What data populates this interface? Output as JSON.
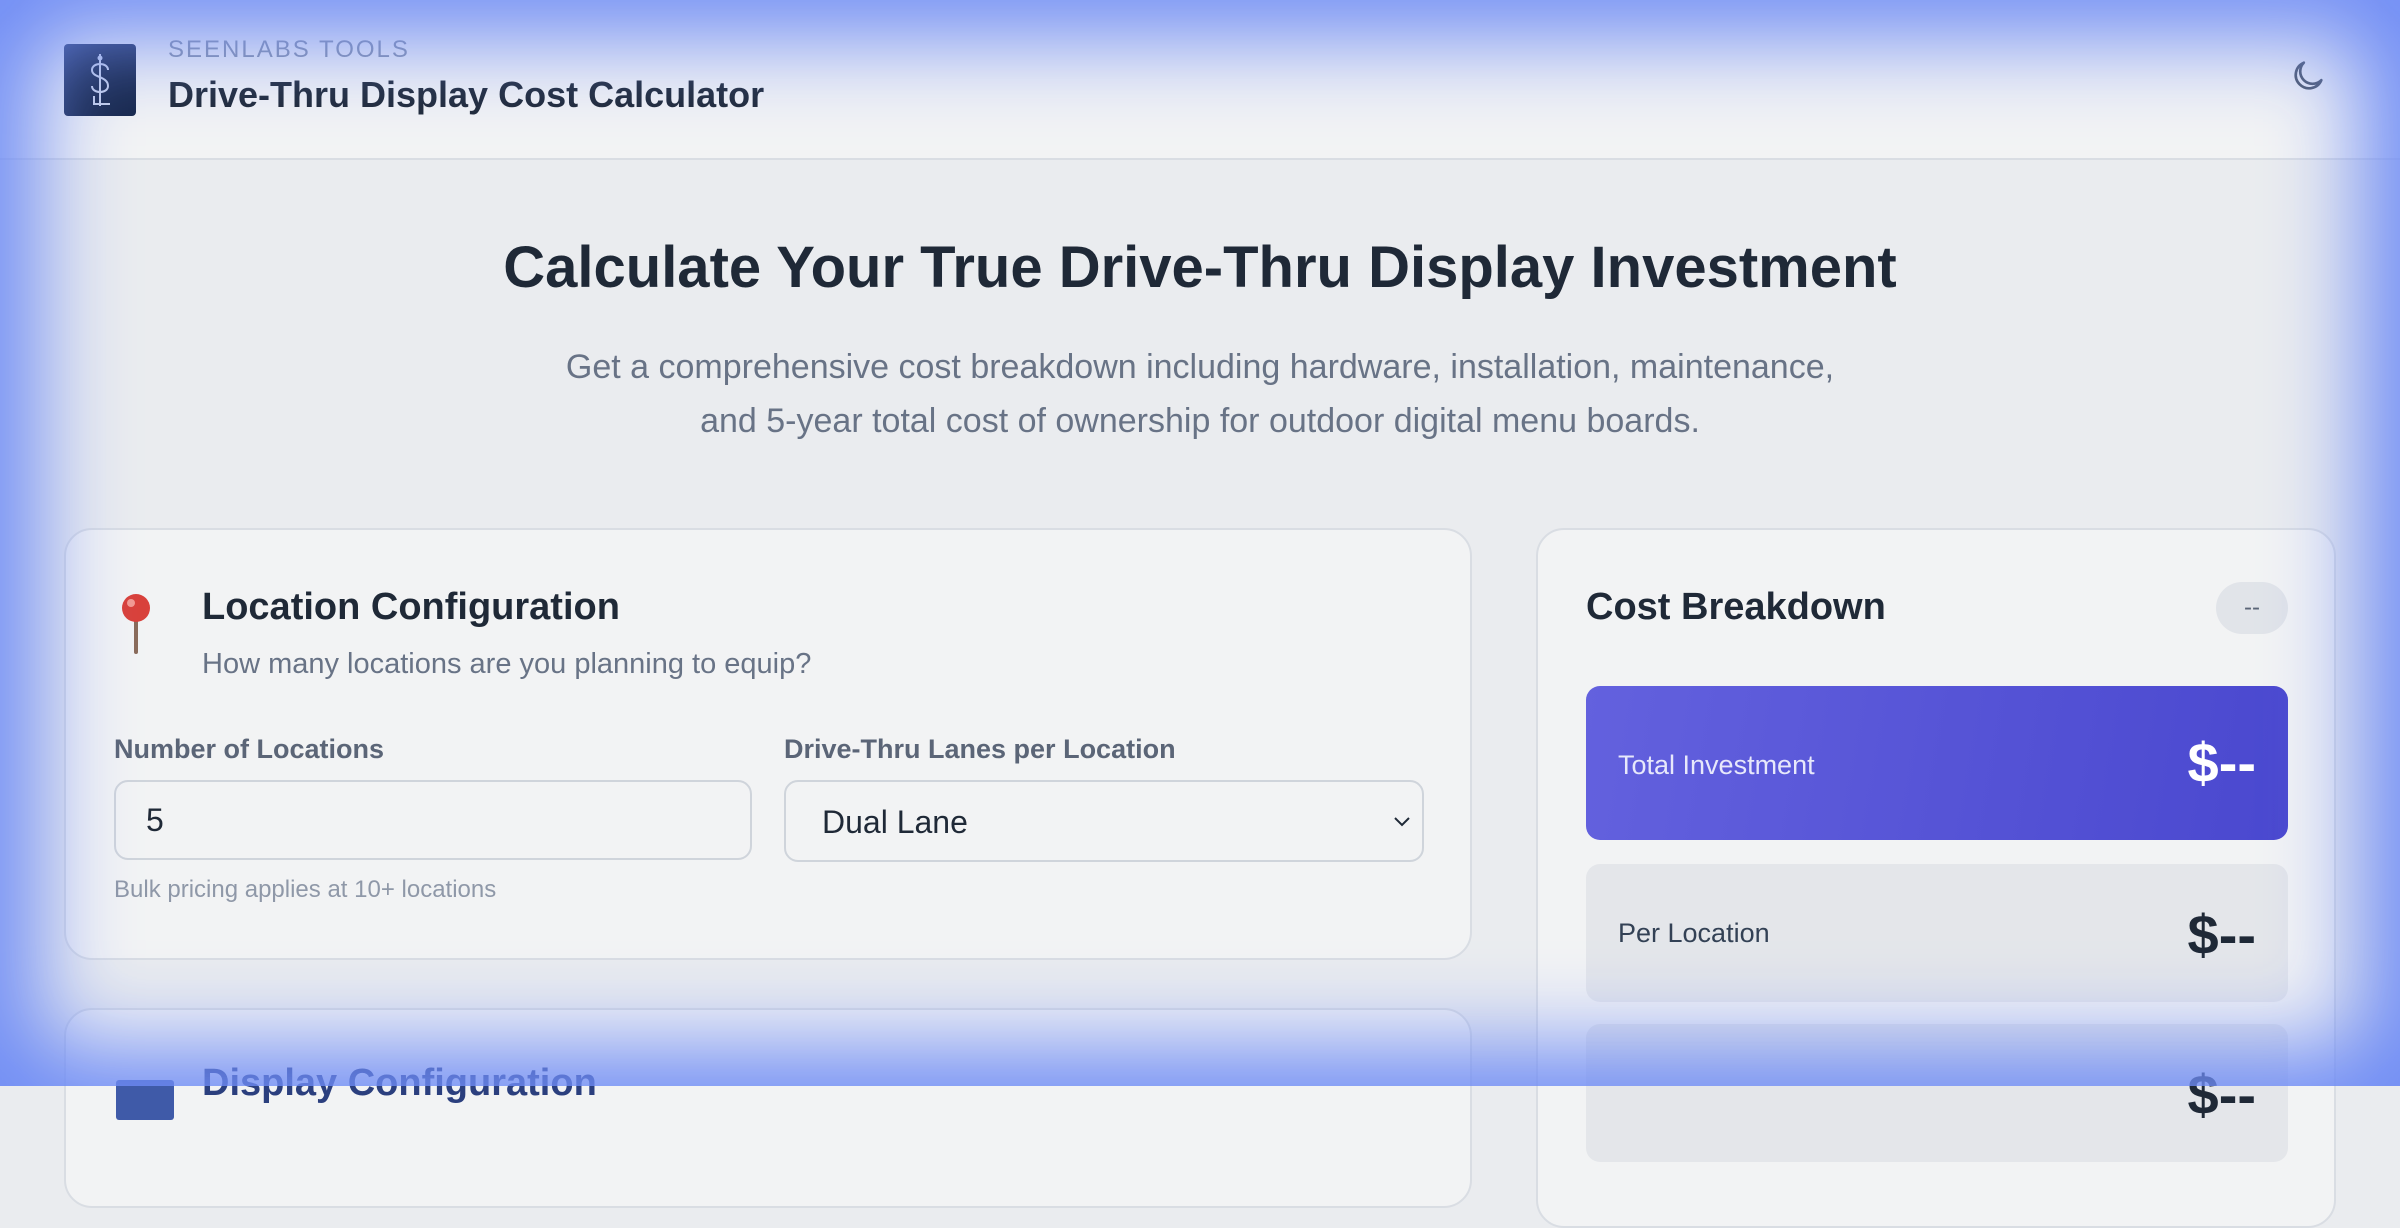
{
  "header": {
    "eyebrow": "SEENLABS TOOLS",
    "title": "Drive-Thru Display Cost Calculator",
    "logo_icon": "seenlabs-logo-icon",
    "theme_icon": "moon-icon"
  },
  "hero": {
    "title": "Calculate Your True Drive-Thru Display Investment",
    "subtitle_line1": "Get a comprehensive cost breakdown including hardware, installation, maintenance,",
    "subtitle_line2": "and 5-year total cost of ownership for outdoor digital menu boards."
  },
  "location": {
    "icon": "pushpin-icon",
    "title": "Location Configuration",
    "description": "How many locations are you planning to equip?",
    "locations_label": "Number of Locations",
    "locations_value": "5",
    "lanes_label": "Drive-Thru Lanes per Location",
    "lanes_selected": "Dual Lane",
    "hint": "Bulk pricing applies at 10+ locations"
  },
  "display": {
    "icon": "display-icon",
    "title": "Display Configuration"
  },
  "cost": {
    "title": "Cost Breakdown",
    "badge": "--",
    "total_label": "Total Investment",
    "total_value": "$--",
    "per_location_label": "Per Location",
    "per_location_value": "$--",
    "next_value": "$--"
  },
  "colors": {
    "accent_start": "#6361de",
    "accent_end": "#4a48cf",
    "vignette": "#6f8cf5",
    "logo_bg": "#17274a"
  }
}
